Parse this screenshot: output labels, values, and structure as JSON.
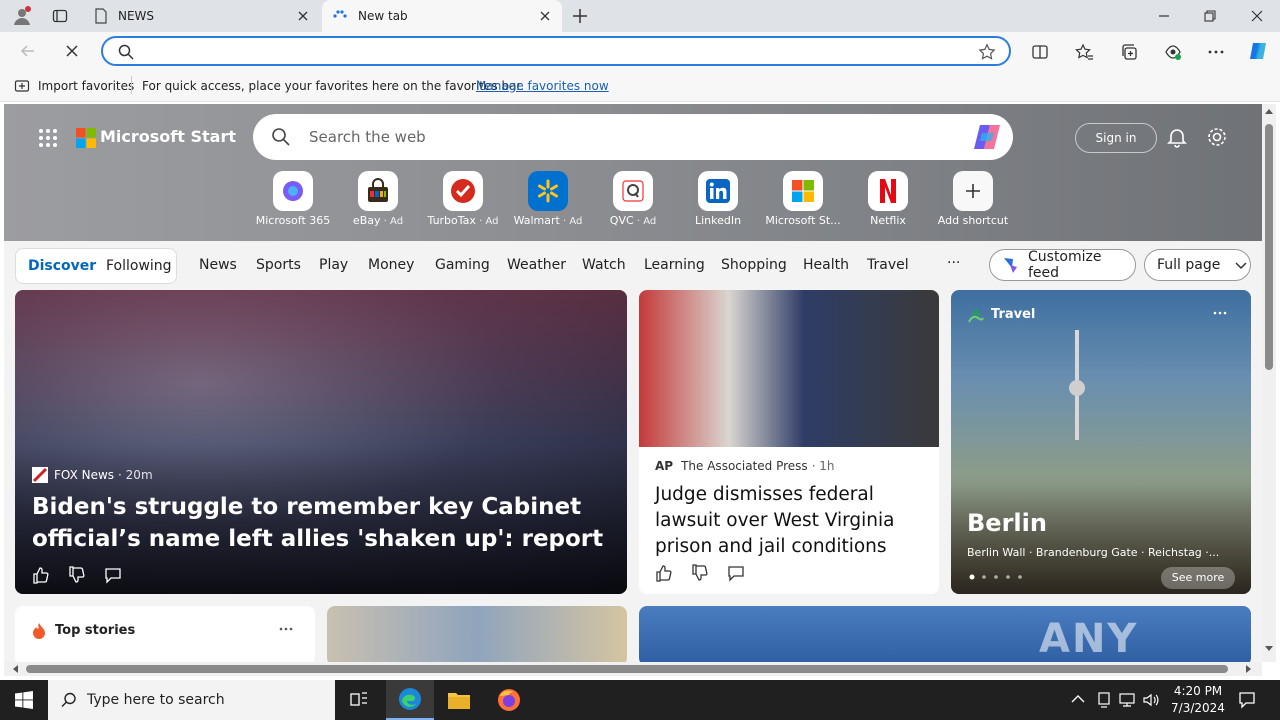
{
  "browser": {
    "tabs": [
      {
        "title": "NEWS",
        "active": false
      },
      {
        "title": "New tab",
        "active": true
      }
    ],
    "address_value": "",
    "favorites_bar": {
      "import_label": "Import favorites",
      "message": "For quick access, place your favorites here on the favorites bar.",
      "manage_link": "Manage favorites now"
    }
  },
  "msn": {
    "brand": "Microsoft Start",
    "search_placeholder": "Search the web",
    "sign_in": "Sign in",
    "shortcuts": [
      {
        "name": "Microsoft 365",
        "ad": "",
        "icon": "microsoft-365-icon"
      },
      {
        "name": "eBay",
        "ad": " · Ad",
        "icon": "ebay-icon"
      },
      {
        "name": "TurboTax",
        "ad": " · Ad",
        "icon": "turbotax-icon"
      },
      {
        "name": "Walmart",
        "ad": " · Ad",
        "icon": "walmart-icon"
      },
      {
        "name": "QVC",
        "ad": " · Ad",
        "icon": "qvc-icon"
      },
      {
        "name": "LinkedIn",
        "ad": "",
        "icon": "linkedin-icon"
      },
      {
        "name": "Microsoft St...",
        "ad": "",
        "icon": "microsoft-store-icon"
      },
      {
        "name": "Netflix",
        "ad": "",
        "icon": "netflix-icon"
      },
      {
        "name": "Add shortcut",
        "ad": "",
        "icon": "plus-icon"
      }
    ],
    "nav": {
      "discover": "Discover",
      "following": "Following",
      "items": [
        "News",
        "Sports",
        "Play",
        "Money",
        "Gaming",
        "Weather",
        "Watch",
        "Learning",
        "Shopping",
        "Health",
        "Travel"
      ],
      "more": "···",
      "customize": "Customize feed",
      "layout": "Full page"
    },
    "cards": {
      "main": {
        "source": "FOX News",
        "time": "· 20m",
        "headline": "Biden's struggle to remember key Cabinet official’s name left allies 'shaken up': report"
      },
      "ap": {
        "source": "The Associated Press",
        "time": "· 1h",
        "headline": "Judge dismisses federal lawsuit over West Virginia prison and jail conditions"
      },
      "travel": {
        "label": "Travel",
        "city": "Berlin",
        "desc": "Berlin Wall · Brandenburg Gate · Reichstag ·...",
        "see_more": "See more"
      },
      "top_stories": {
        "label": "Top stories"
      }
    },
    "watermark": "ANY RUN"
  },
  "taskbar": {
    "search_placeholder": "Type here to search",
    "time": "4:20 PM",
    "date": "7/3/2024"
  },
  "colors": {
    "accent": "#0067c0",
    "omnibox_border": "#2b7de0",
    "taskbar": "#202020"
  }
}
